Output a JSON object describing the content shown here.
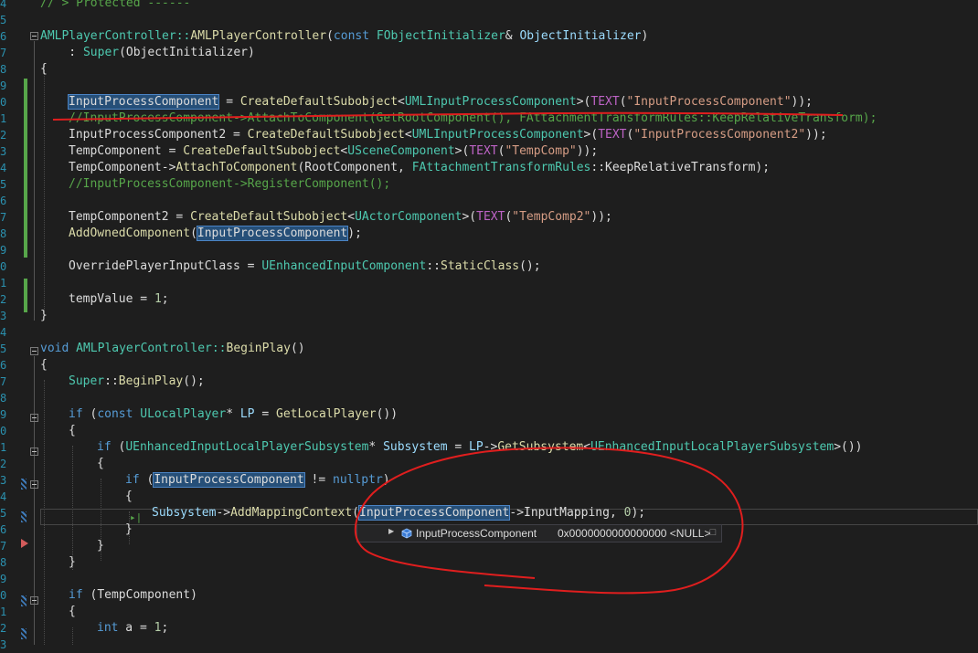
{
  "editor": {
    "line_numbers": [
      "4",
      "5",
      "6",
      "7",
      "8",
      "9",
      "0",
      "1",
      "2",
      "3",
      "4",
      "5",
      "6",
      "7",
      "8",
      "9",
      "0",
      "1",
      "2",
      "3",
      "4",
      "5",
      "6",
      "7",
      "8",
      "9",
      "0",
      "1",
      "2",
      "3",
      "4",
      "5",
      "6",
      "7",
      "8",
      "9",
      "0",
      "1",
      "2",
      "3"
    ],
    "lines": {
      "l0": "// > Protected ------",
      "l2a": "AMLPlayerController::",
      "l2b": "AMLPlayerController",
      "l2c": "(",
      "l2d": "const",
      "l2e": " FObjectInitializer",
      "l2f": "& ",
      "l2g": "ObjectInitializer",
      "l2h": ")",
      "l3a": "    : ",
      "l3b": "Super",
      "l3c": "(ObjectInitializer)",
      "l4": "{",
      "l6a": "InputProcessComponent",
      "l6b": " = ",
      "l6c": "CreateDefaultSubobject",
      "l6d": "<",
      "l6e": "UMLInputProcessComponent",
      "l6f": ">(",
      "l6g": "TEXT",
      "l6h": "(",
      "l6i": "\"InputProcessComponent\"",
      "l6j": "));",
      "l7": "//InputProcessComponent->AttachToComponent(GetRootComponent(), FAttachmentTransformRules::KeepRelativeTransform);",
      "l8a": "InputProcessComponent2",
      "l8b": " = ",
      "l8c": "CreateDefaultSubobject",
      "l8d": "<",
      "l8e": "UMLInputProcessComponent",
      "l8f": ">(",
      "l8g": "TEXT",
      "l8h": "(",
      "l8i": "\"InputProcessComponent2\"",
      "l8j": "));",
      "l9a": "TempComponent",
      "l9b": " = ",
      "l9c": "CreateDefaultSubobject",
      "l9d": "<",
      "l9e": "USceneComponent",
      "l9f": ">(",
      "l9g": "TEXT",
      "l9h": "(",
      "l9i": "\"TempComp\"",
      "l9j": "));",
      "l10a": "TempComponent",
      "l10b": "->",
      "l10c": "AttachToComponent",
      "l10d": "(",
      "l10e": "RootComponent",
      "l10f": ", ",
      "l10g": "FAttachmentTransformRules",
      "l10h": "::",
      "l10i": "KeepRelativeTransform",
      "l10j": ");",
      "l11": "//InputProcessComponent->RegisterComponent();",
      "l13a": "TempComponent2",
      "l13b": " = ",
      "l13c": "CreateDefaultSubobject",
      "l13d": "<",
      "l13e": "UActorComponent",
      "l13f": ">(",
      "l13g": "TEXT",
      "l13h": "(",
      "l13i": "\"TempComp2\"",
      "l13j": "));",
      "l14a": "AddOwnedComponent",
      "l14b": "(",
      "l14c": "InputProcessComponent",
      "l14d": ");",
      "l16a": "OverridePlayerInputClass",
      "l16b": " = ",
      "l16c": "UEnhancedInputComponent",
      "l16d": "::",
      "l16e": "StaticClass",
      "l16f": "();",
      "l18a": "tempValue",
      "l18b": " = ",
      "l18c": "1",
      "l18d": ";",
      "l19": "}",
      "l21a": "void",
      "l21b": " AMLPlayerController::",
      "l21c": "BeginPlay",
      "l21d": "()",
      "l22": "{",
      "l23a": "Super",
      "l23b": "::",
      "l23c": "BeginPlay",
      "l23d": "();",
      "l25a": "if",
      "l25b": " (",
      "l25c": "const",
      "l25d": " ULocalPlayer",
      "l25e": "* ",
      "l25f": "LP",
      "l25g": " = ",
      "l25h": "GetLocalPlayer",
      "l25i": "())",
      "l26": "{",
      "l27a": "if",
      "l27b": " (",
      "l27c": "UEnhancedInputLocalPlayerSubsystem",
      "l27d": "* ",
      "l27e": "Subsystem",
      "l27f": " = ",
      "l27g": "LP",
      "l27h": "->",
      "l27i": "GetSubsystem",
      "l27j": "<",
      "l27k": "UEnhancedInputLocalPlayerSubsystem",
      "l27l": ">())",
      "l28": "{",
      "l29a": "if",
      "l29b": " (",
      "l29c": "InputProcessComponent",
      "l29d": " != ",
      "l29e": "nullptr",
      "l29f": ")",
      "l30": "{",
      "l31a": "Subsystem",
      "l31b": "->",
      "l31c": "AddMappingContext",
      "l31d": "(",
      "l31e": "InputProcessComponent",
      "l31f": "->",
      "l31g": "InputMapping",
      "l31h": ", ",
      "l31i": "0",
      "l31j": ");",
      "l32": "}",
      "l33": "}",
      "l34": "}",
      "l36a": "if",
      "l36b": " (",
      "l36c": "TempComponent",
      "l36d": ")",
      "l37": "{",
      "l38a": "int",
      "l38b": " a = ",
      "l38c": "1",
      "l38d": ";"
    }
  },
  "datatip": {
    "name": "InputProcessComponent",
    "value": "0x0000000000000000 <NULL>",
    "expand_icon": "expand-triangle-icon",
    "value_icon": "variable-object-icon",
    "pin_icon": "pin-icon"
  },
  "colors": {
    "annotation": "#e01e1e",
    "highlight": "#264f78",
    "change_bar": "#57a64a"
  }
}
